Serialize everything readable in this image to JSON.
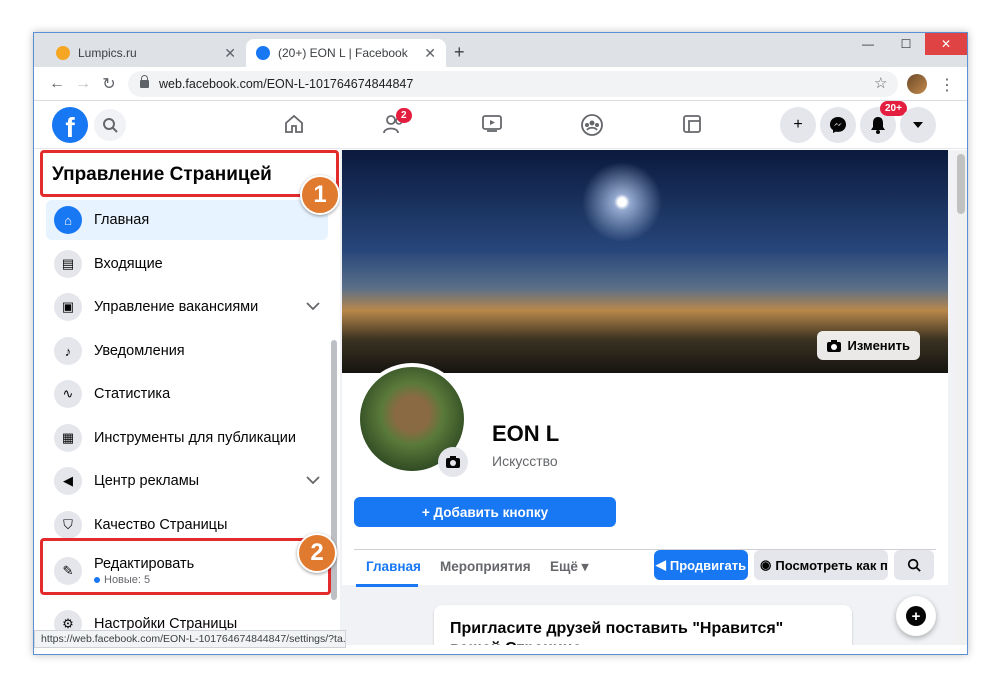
{
  "browser": {
    "tabs": [
      {
        "title": "Lumpics.ru",
        "favicon_color": "#f5a623"
      },
      {
        "title": "(20+) EON L | Facebook",
        "favicon_color": "#1877f2"
      }
    ],
    "url": "web.facebook.com/EON-L-101764674844847",
    "status_url": "https://web.facebook.com/EON-L-101764674844847/settings/?ta..."
  },
  "fb_header": {
    "logo": "f",
    "friends_badge": "2",
    "notifications_badge": "20+"
  },
  "sidebar": {
    "title": "Управление Страницей",
    "items": [
      {
        "label": "Главная",
        "icon": "home-icon",
        "active": true
      },
      {
        "label": "Входящие",
        "icon": "inbox-icon"
      },
      {
        "label": "Управление вакансиями",
        "icon": "briefcase-icon",
        "chevron": true
      },
      {
        "label": "Уведомления",
        "icon": "bell-icon"
      },
      {
        "label": "Статистика",
        "icon": "chart-icon"
      },
      {
        "label": "Инструменты для публикации",
        "icon": "tools-icon"
      },
      {
        "label": "Центр рекламы",
        "icon": "megaphone-icon",
        "chevron": true
      },
      {
        "label": "Качество Страницы",
        "icon": "shield-icon"
      },
      {
        "label": "Редактировать",
        "sub": "Новые: 5",
        "icon": "pencil-icon"
      },
      {
        "label": "Настройки Страницы",
        "icon": "gear-icon"
      }
    ]
  },
  "annotations": {
    "step1": "1",
    "step2": "2",
    "color": "#e32b2b"
  },
  "page": {
    "cover_button": "Изменить",
    "name": "EON L",
    "category": "Искусство",
    "add_button": "+ Добавить кнопку",
    "tabs": [
      "Главная",
      "Мероприятия",
      "Ещё"
    ],
    "promote": "Продвигать",
    "view_as": "Посмотреть как п...",
    "invite_text": "Пригласите друзей поставить \"Нравится\" вашей Странице"
  },
  "colors": {
    "facebook_blue": "#1877f2",
    "badge_red": "#e41e3f",
    "window_frame": "#5b8fd6"
  }
}
